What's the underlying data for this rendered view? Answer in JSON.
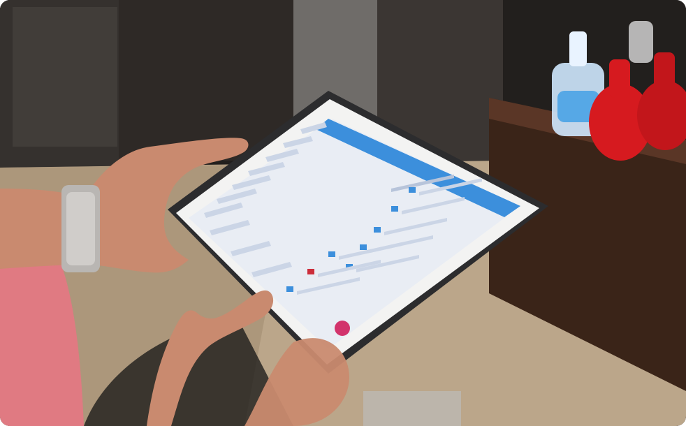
{
  "photo": {
    "subject": "hands-holding-tablet",
    "colors": {
      "background_dark": "#1f1c1a",
      "floor": "#cbb79c",
      "pillar": "#6e6a66",
      "shelf_wood": "#3a2418",
      "shirt": "#e07a82",
      "skin": "#c98a6f",
      "watch": "#b9b6b3",
      "tablet_case": "#2c2c2e",
      "tablet_bezel": "#f3f3f2",
      "screen_bg": "#e9edf4",
      "app_header": "#3c8fdc",
      "fab": "#d2336b",
      "bottle_red": "#d61a1f",
      "bottle_blue": "#4aa3e6"
    }
  },
  "tablet_screen": {
    "header_title": "",
    "panel_title": "",
    "left_rows": 10,
    "right_rows": 8
  }
}
